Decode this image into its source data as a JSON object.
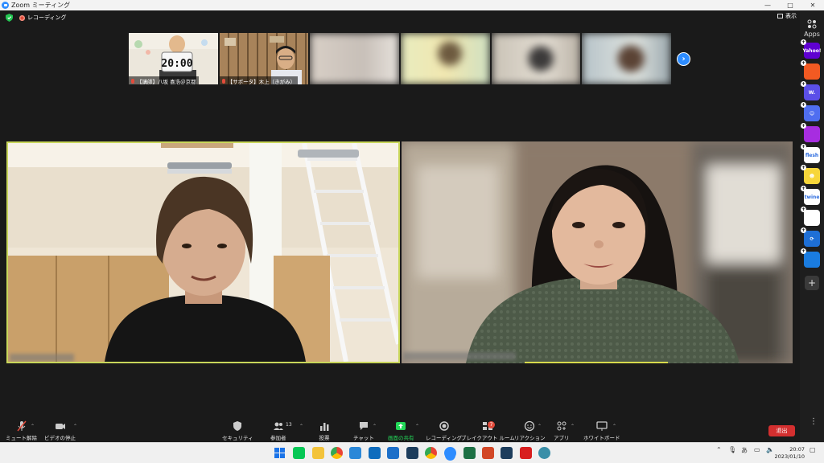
{
  "window": {
    "title": "Zoom ミーティング",
    "controls": [
      "—",
      "□",
      "✕"
    ]
  },
  "status": {
    "recording_label": "レコーディング",
    "view_label": "表示"
  },
  "strip": {
    "participants": [
      {
        "name": "【講師】八坂 喜浩＠京都",
        "timer": "20:00"
      },
      {
        "name": "【サポータ】木上（きがみ）"
      },
      {
        "name": ""
      },
      {
        "name": ""
      },
      {
        "name": ""
      },
      {
        "name": ""
      }
    ]
  },
  "sidebar": {
    "label": "Apps",
    "apps": [
      {
        "name": "yahoo",
        "text": "Yahoo!",
        "color": "#5f01d1"
      },
      {
        "name": "app-orange",
        "text": "",
        "color": "#f25a22"
      },
      {
        "name": "app-w",
        "text": "W.",
        "color": "#5b4fe8"
      },
      {
        "name": "app-smile",
        "text": "☺",
        "color": "#4f6ef0"
      },
      {
        "name": "app-signal",
        "text": "",
        "color": "#a72de0"
      },
      {
        "name": "app-flesh",
        "text": "flesh",
        "color": "#ffffff"
      },
      {
        "name": "app-emoji",
        "text": "☻",
        "color": "#f7d63a"
      },
      {
        "name": "app-twine",
        "text": "twine",
        "color": "#ffffff"
      },
      {
        "name": "app-grid",
        "text": "",
        "color": "#ffffff"
      },
      {
        "name": "app-sync",
        "text": "⟳",
        "color": "#1e6fd6"
      },
      {
        "name": "app-blue",
        "text": "",
        "color": "#1a7ce0"
      }
    ],
    "add_label": "+"
  },
  "toolbar": {
    "mute": "ミュート解除",
    "video": "ビデオの停止",
    "security": "セキュリティ",
    "participants": "参加者",
    "participants_count": "13",
    "polls": "投票",
    "chat": "チャット",
    "share": "画面の共有",
    "record": "レコーディング",
    "breakout": "ブレイクアウト ルーム",
    "breakout_badge": "7",
    "reactions": "リアクション",
    "apps": "アプリ",
    "whiteboard": "ホワイトボード",
    "leave": "退出",
    "more": "⋮"
  },
  "taskbar": {
    "ime": "あ",
    "time": "20:07",
    "date": "2023/01/10"
  },
  "colors": {
    "active_speaker_border": "#c8d65a",
    "leave": "#d32f2f",
    "share": "#23d959",
    "accent": "#2d8cff"
  }
}
